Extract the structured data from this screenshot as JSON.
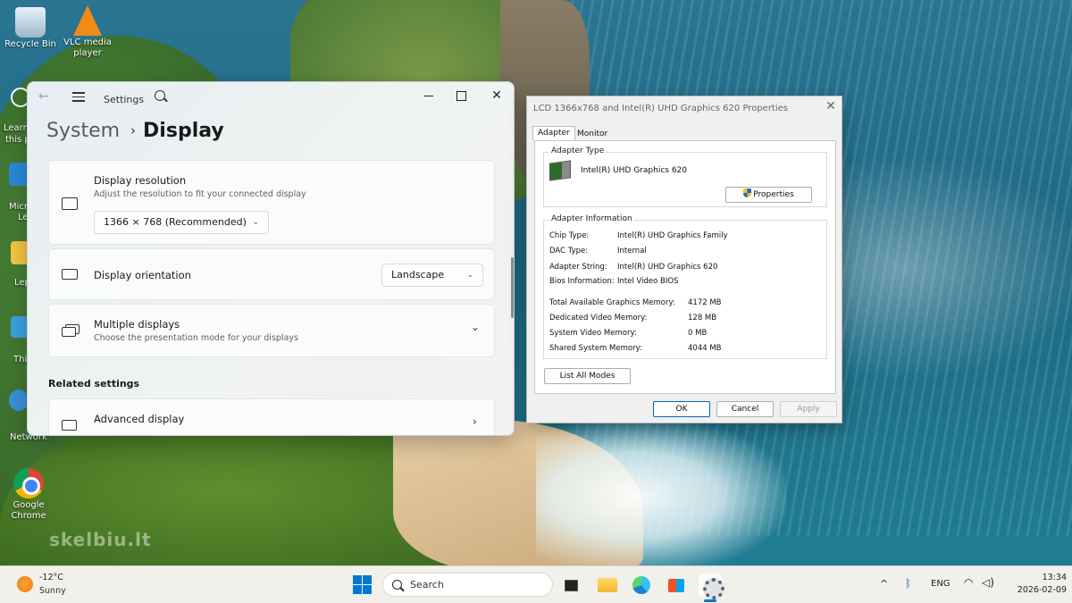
{
  "desktop": {
    "icons": {
      "recycle_bin": "Recycle Bin",
      "vlc": "VLC media player",
      "chrome": "Google Chrome",
      "partial_learn": "Learn",
      "partial_this": "this p",
      "partial_micro": "Micro",
      "partial_le": "Le",
      "partial_lep": "Lep",
      "partial_thi": "Thi",
      "partial_network": "Network"
    },
    "watermark": "skelbiu.lt"
  },
  "settings": {
    "app_title": "Settings",
    "breadcrumb": {
      "root": "System",
      "separator": "›",
      "current": "Display"
    },
    "resolution": {
      "title": "Display resolution",
      "subtitle": "Adjust the resolution to fit your connected display",
      "value": "1366 × 768 (Recommended)"
    },
    "orientation": {
      "title": "Display orientation",
      "value": "Landscape"
    },
    "multiple_displays": {
      "title": "Multiple displays",
      "subtitle": "Choose the presentation mode for your displays"
    },
    "related_settings_label": "Related settings",
    "advanced_display": {
      "title": "Advanced display"
    }
  },
  "properties": {
    "title": "LCD 1366x768 and Intel(R) UHD Graphics 620 Properties",
    "tabs": [
      "Adapter",
      "Monitor"
    ],
    "adapter_type": {
      "label": "Adapter Type",
      "name": "Intel(R) UHD Graphics 620",
      "properties_button": "Properties"
    },
    "adapter_info": {
      "label": "Adapter Information",
      "rows": [
        {
          "key": "Chip Type:",
          "value": "Intel(R) UHD Graphics Family"
        },
        {
          "key": "DAC Type:",
          "value": "Internal"
        },
        {
          "key": "Adapter String:",
          "value": "Intel(R) UHD Graphics 620"
        },
        {
          "key": "Bios Information:",
          "value": "Intel Video BIOS"
        }
      ],
      "memory": [
        {
          "key": "Total Available Graphics Memory:",
          "value": "4172 MB"
        },
        {
          "key": "Dedicated Video Memory:",
          "value": "128 MB"
        },
        {
          "key": "System Video Memory:",
          "value": "0 MB"
        },
        {
          "key": "Shared System Memory:",
          "value": "4044 MB"
        }
      ]
    },
    "list_all_modes": "List All Modes",
    "buttons": {
      "ok": "OK",
      "cancel": "Cancel",
      "apply": "Apply"
    }
  },
  "taskbar": {
    "weather": {
      "temp": "-12°C",
      "desc": "Sunny"
    },
    "search_label": "Search",
    "tray": {
      "chevron": "^",
      "lang": "ENG"
    },
    "clock": {
      "time": "13:34",
      "date": "2026-02-09"
    }
  }
}
